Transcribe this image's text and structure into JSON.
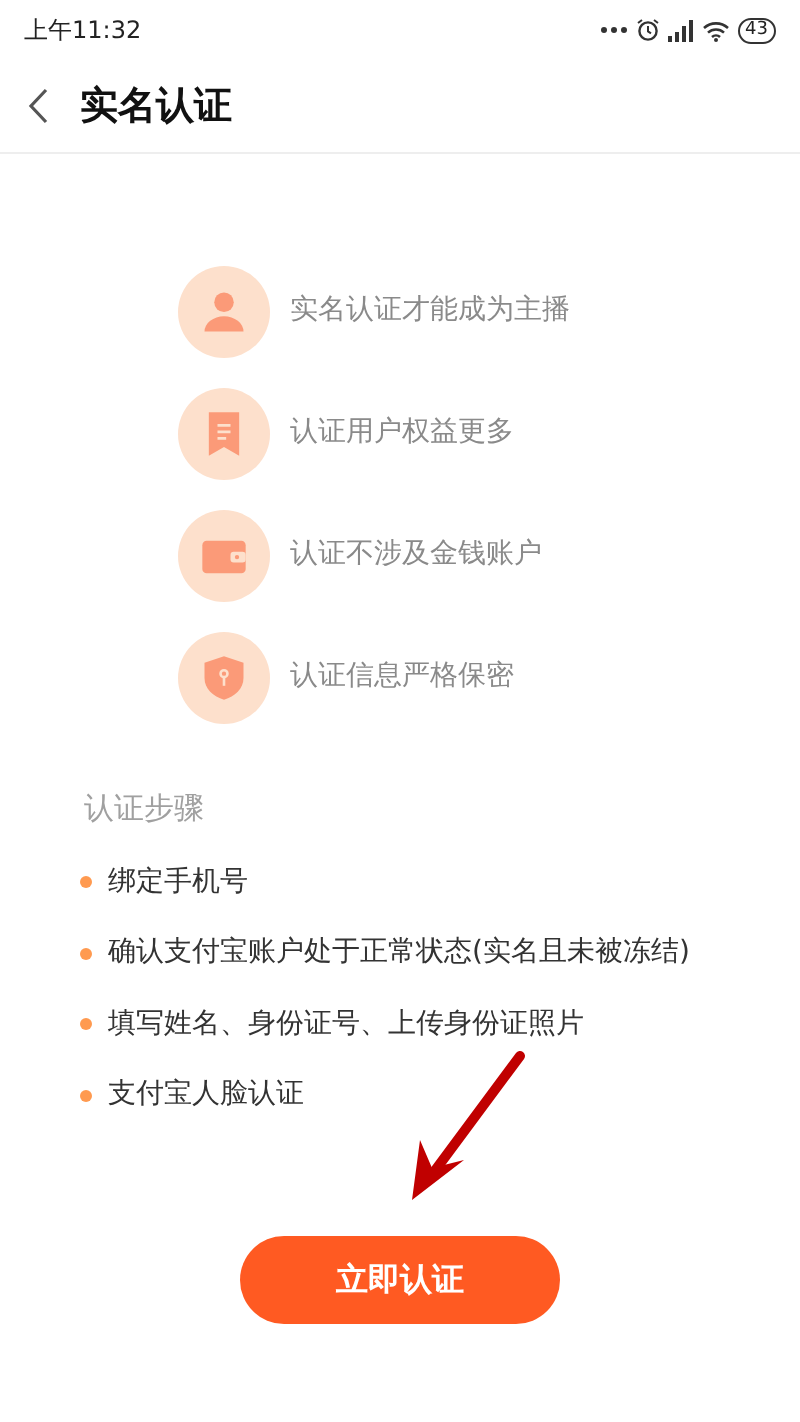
{
  "status_bar": {
    "time": "上午11:32",
    "battery": "43"
  },
  "header": {
    "title": "实名认证"
  },
  "benefits": [
    {
      "kind": "person",
      "text": "实名认证才能成为主播"
    },
    {
      "kind": "receipt",
      "text": "认证用户权益更多"
    },
    {
      "kind": "wallet",
      "text": "认证不涉及金钱账户"
    },
    {
      "kind": "shield",
      "text": "认证信息严格保密"
    }
  ],
  "steps": {
    "title": "认证步骤",
    "items": [
      "绑定手机号",
      "确认支付宝账户处于正常状态(实名且未被冻结)",
      "填写姓名、身份证号、上传身份证照片",
      "支付宝人脸认证"
    ]
  },
  "button": {
    "label": "立即认证"
  }
}
